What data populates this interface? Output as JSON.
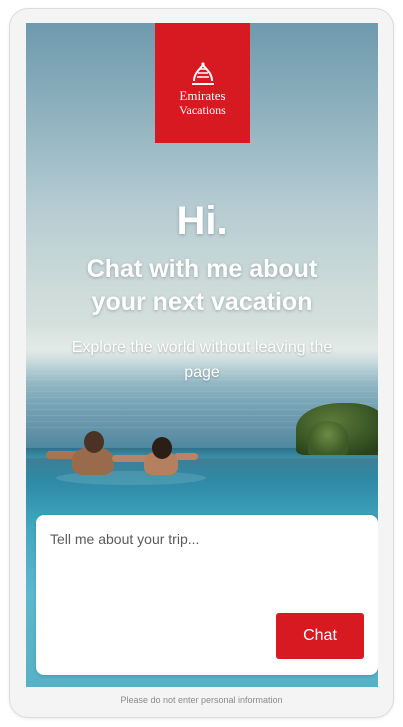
{
  "brand": {
    "logo_line1": "Emirates",
    "logo_line2": "Vacations",
    "logo_color": "#d71921",
    "emblem_icon": "emirates-calligraphy-emblem"
  },
  "hero": {
    "greeting": "Hi.",
    "headline_line1": "Chat with me about",
    "headline_line2": "your next vacation",
    "subheadline": "Explore the world without leaving the page"
  },
  "chat": {
    "placeholder": "Tell me about your trip...",
    "value": "",
    "button_label": "Chat",
    "button_color": "#d71921"
  },
  "footer": {
    "disclaimer": "Please do not enter personal information"
  }
}
